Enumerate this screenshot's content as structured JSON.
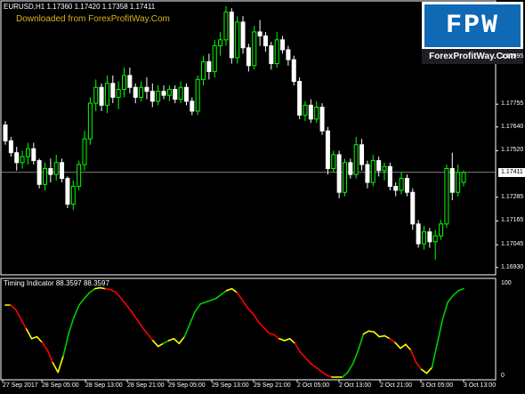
{
  "chart_header": {
    "symbol_info": "EURUSD,H1  1.17360 1.17420 1.17358 1.17411",
    "watermark": "Downloaded from ForexProfitWay.Com"
  },
  "logo": {
    "text": "FPW",
    "url": "ForexProfitWay.Com",
    "bg_color": "#0f69b4"
  },
  "price_axis": {
    "ticks": [
      "1.17995",
      "1.17755",
      "1.17640",
      "1.17520",
      "1.17285",
      "1.17165",
      "1.17045",
      "1.16930"
    ],
    "current_price": "1.17411"
  },
  "indicator": {
    "label": "Timing Indicator 88.3597 88.3597",
    "scale_max": "100",
    "scale_min": "0"
  },
  "time_axis": {
    "labels": [
      "27 Sep 2017",
      "28 Sep 05:00",
      "28 Sep 13:00",
      "28 Sep 21:00",
      "29 Sep 05:00",
      "29 Sep 13:00",
      "29 Sep 21:00",
      "2 Oct 05:00",
      "2 Oct 13:00",
      "2 Oct 21:00",
      "3 Oct 05:00",
      "3 Oct 13:00"
    ]
  },
  "colors": {
    "bull_candle": "#00ff00",
    "bear_candle": "#ffffff",
    "indicator_up": "#00cc00",
    "indicator_down": "#ff0000",
    "indicator_flat": "#ffff00"
  },
  "chart_data": {
    "type": "candlestick",
    "symbol": "EURUSD",
    "timeframe": "H1",
    "ylim": [
      1.1692,
      1.1825
    ],
    "candles": [
      [
        1.1765,
        1.1767,
        1.1755,
        1.1757
      ],
      [
        1.1757,
        1.1759,
        1.1749,
        1.1751
      ],
      [
        1.1751,
        1.1754,
        1.1742,
        1.1746
      ],
      [
        1.1746,
        1.1752,
        1.1743,
        1.1749
      ],
      [
        1.1749,
        1.1756,
        1.1745,
        1.1753
      ],
      [
        1.1753,
        1.1756,
        1.1745,
        1.1747
      ],
      [
        1.1747,
        1.1748,
        1.1733,
        1.1735
      ],
      [
        1.1735,
        1.1746,
        1.1732,
        1.1743
      ],
      [
        1.1743,
        1.1748,
        1.1736,
        1.174
      ],
      [
        1.174,
        1.175,
        1.1737,
        1.1746
      ],
      [
        1.1746,
        1.1748,
        1.1736,
        1.1738
      ],
      [
        1.1738,
        1.1739,
        1.1723,
        1.1725
      ],
      [
        1.1725,
        1.1737,
        1.1722,
        1.1734
      ],
      [
        1.1734,
        1.1747,
        1.1732,
        1.1745
      ],
      [
        1.1745,
        1.1762,
        1.1742,
        1.1758
      ],
      [
        1.1758,
        1.1779,
        1.1755,
        1.1776
      ],
      [
        1.1776,
        1.1788,
        1.1772,
        1.1784
      ],
      [
        1.1784,
        1.1786,
        1.1772,
        1.1775
      ],
      [
        1.1775,
        1.179,
        1.1771,
        1.1786
      ],
      [
        1.1786,
        1.179,
        1.1776,
        1.1779
      ],
      [
        1.1779,
        1.1787,
        1.1773,
        1.1783
      ],
      [
        1.1783,
        1.1794,
        1.1779,
        1.179
      ],
      [
        1.179,
        1.1794,
        1.1781,
        1.1784
      ],
      [
        1.1784,
        1.1786,
        1.1776,
        1.1779
      ],
      [
        1.1779,
        1.1787,
        1.1777,
        1.1784
      ],
      [
        1.1784,
        1.1789,
        1.1778,
        1.1782
      ],
      [
        1.1782,
        1.1786,
        1.1774,
        1.1777
      ],
      [
        1.1777,
        1.1785,
        1.1775,
        1.1782
      ],
      [
        1.1782,
        1.1785,
        1.1778,
        1.178
      ],
      [
        1.178,
        1.1785,
        1.1777,
        1.1783
      ],
      [
        1.1783,
        1.1785,
        1.1776,
        1.1778
      ],
      [
        1.1778,
        1.1787,
        1.1776,
        1.1784
      ],
      [
        1.1784,
        1.1786,
        1.1775,
        1.1777
      ],
      [
        1.1777,
        1.1779,
        1.177,
        1.1772
      ],
      [
        1.1772,
        1.179,
        1.177,
        1.1788
      ],
      [
        1.1788,
        1.18,
        1.1785,
        1.1797
      ],
      [
        1.1797,
        1.1801,
        1.1788,
        1.1792
      ],
      [
        1.1792,
        1.1808,
        1.1789,
        1.1805
      ],
      [
        1.1805,
        1.1812,
        1.18,
        1.1808
      ],
      [
        1.1808,
        1.1825,
        1.1805,
        1.1822
      ],
      [
        1.1822,
        1.1824,
        1.1796,
        1.1799
      ],
      [
        1.1799,
        1.182,
        1.1796,
        1.1817
      ],
      [
        1.1817,
        1.182,
        1.1801,
        1.1804
      ],
      [
        1.1804,
        1.1806,
        1.1792,
        1.1795
      ],
      [
        1.1795,
        1.1815,
        1.1793,
        1.1812
      ],
      [
        1.1812,
        1.1818,
        1.1805,
        1.181
      ],
      [
        1.181,
        1.1812,
        1.1802,
        1.1805
      ],
      [
        1.1805,
        1.1807,
        1.1793,
        1.1796
      ],
      [
        1.1796,
        1.1812,
        1.1794,
        1.1808
      ],
      [
        1.1808,
        1.181,
        1.1801,
        1.1803
      ],
      [
        1.1803,
        1.1805,
        1.1795,
        1.1798
      ],
      [
        1.1798,
        1.18,
        1.1785,
        1.1787
      ],
      [
        1.1787,
        1.1789,
        1.1768,
        1.177
      ],
      [
        1.177,
        1.1777,
        1.1767,
        1.1775
      ],
      [
        1.1775,
        1.1778,
        1.1766,
        1.1768
      ],
      [
        1.1768,
        1.1777,
        1.1766,
        1.1774
      ],
      [
        1.1774,
        1.1776,
        1.176,
        1.1762
      ],
      [
        1.1762,
        1.1764,
        1.174,
        1.1743
      ],
      [
        1.1743,
        1.1752,
        1.1741,
        1.175
      ],
      [
        1.175,
        1.1752,
        1.1728,
        1.1731
      ],
      [
        1.1731,
        1.1748,
        1.1729,
        1.1746
      ],
      [
        1.1746,
        1.1748,
        1.1738,
        1.174
      ],
      [
        1.174,
        1.1759,
        1.1738,
        1.1755
      ],
      [
        1.1755,
        1.1758,
        1.1742,
        1.1745
      ],
      [
        1.1745,
        1.1747,
        1.1733,
        1.1736
      ],
      [
        1.1736,
        1.175,
        1.1734,
        1.1747
      ],
      [
        1.1747,
        1.1749,
        1.1739,
        1.1742
      ],
      [
        1.1742,
        1.1746,
        1.1737,
        1.1744
      ],
      [
        1.1744,
        1.1746,
        1.1732,
        1.1734
      ],
      [
        1.1734,
        1.1736,
        1.1729,
        1.1732
      ],
      [
        1.1732,
        1.1741,
        1.173,
        1.1738
      ],
      [
        1.1738,
        1.174,
        1.1729,
        1.1731
      ],
      [
        1.1731,
        1.1733,
        1.1712,
        1.1715
      ],
      [
        1.1715,
        1.1717,
        1.1703,
        1.1705
      ],
      [
        1.1705,
        1.1714,
        1.1702,
        1.1711
      ],
      [
        1.1711,
        1.1713,
        1.1703,
        1.1706
      ],
      [
        1.1706,
        1.1712,
        1.1697,
        1.1709
      ],
      [
        1.1709,
        1.1717,
        1.1707,
        1.1715
      ],
      [
        1.1715,
        1.1745,
        1.1713,
        1.1743
      ],
      [
        1.1743,
        1.1751,
        1.1727,
        1.1731
      ],
      [
        1.1731,
        1.1745,
        1.1729,
        1.1741
      ],
      [
        1.1736,
        1.1742,
        1.1734,
        1.1741
      ]
    ],
    "indicator_series": {
      "name": "Timing Indicator",
      "current_value": 88.3597,
      "ylim": [
        0,
        100
      ],
      "values": [
        75,
        75,
        70,
        60,
        50,
        40,
        42,
        36,
        28,
        15,
        5,
        22,
        45,
        62,
        75,
        82,
        88,
        92,
        93,
        92,
        91,
        88,
        82,
        75,
        68,
        60,
        52,
        45,
        38,
        32,
        35,
        38,
        40,
        35,
        42,
        55,
        68,
        76,
        78,
        80,
        82,
        86,
        90,
        92,
        88,
        80,
        72,
        66,
        58,
        52,
        46,
        44,
        40,
        38,
        40,
        35,
        26,
        20,
        14,
        10,
        6,
        2,
        0,
        0,
        0,
        5,
        14,
        28,
        45,
        48,
        47,
        42,
        43,
        40,
        36,
        30,
        34,
        28,
        15,
        8,
        4,
        10,
        35,
        60,
        78,
        85,
        90,
        92
      ],
      "segment_colors": "red when falling, green when rising, yellow at turning points"
    }
  }
}
